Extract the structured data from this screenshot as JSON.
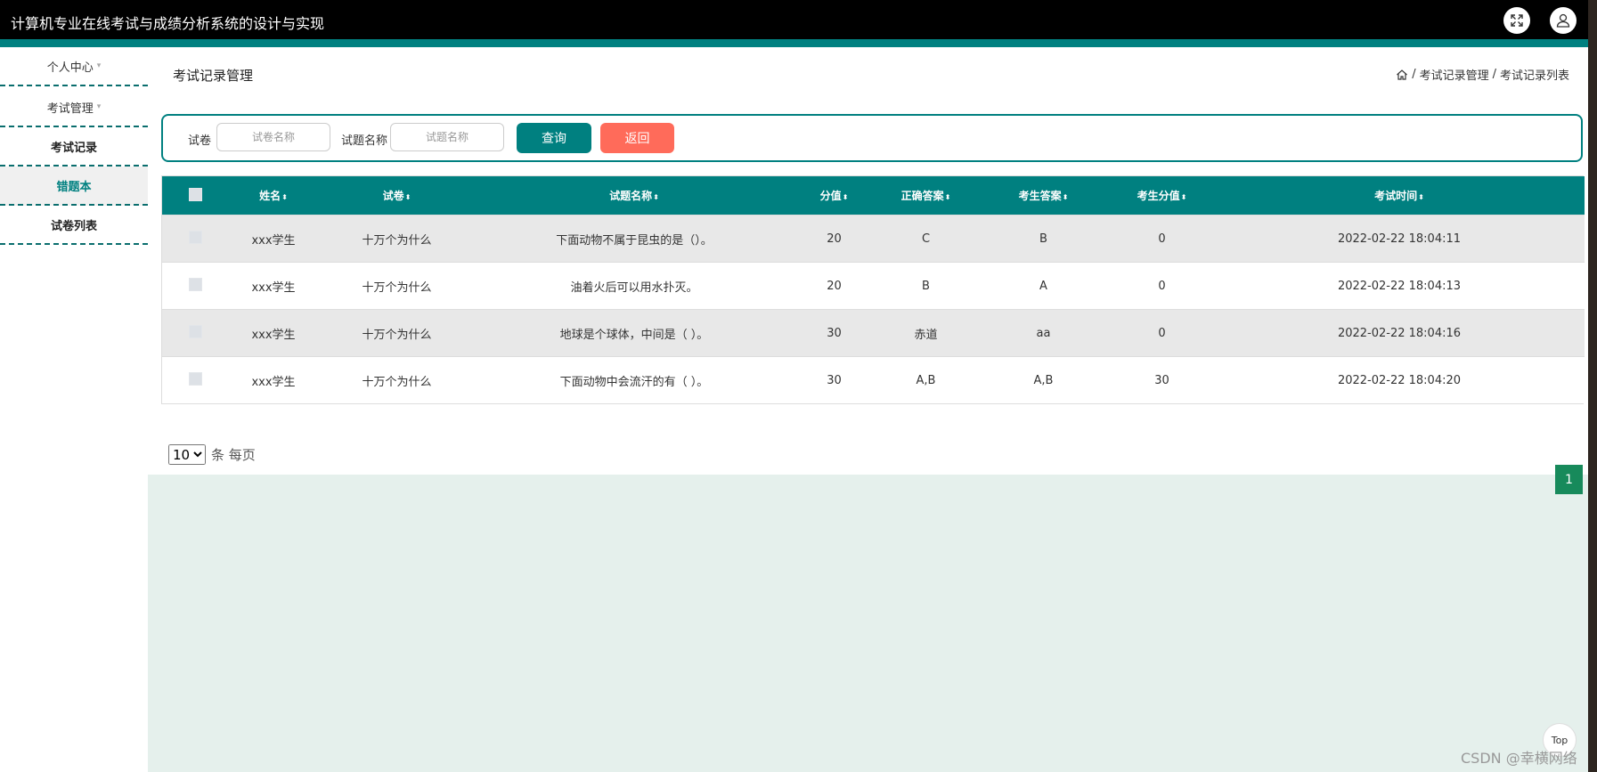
{
  "app": {
    "title": "计算机专业在线考试与成绩分析系统的设计与实现"
  },
  "header": {
    "fullscreen_icon": "expand-icon",
    "user_icon": "user-icon"
  },
  "sidebar": {
    "items": [
      {
        "label": "个人中心",
        "caret": "▾"
      },
      {
        "label": "考试管理",
        "caret": "▾"
      },
      {
        "label": "考试记录"
      },
      {
        "label": "错题本"
      },
      {
        "label": "试卷列表"
      }
    ]
  },
  "page": {
    "title": "考试记录管理",
    "breadcrumb": [
      "考试记录管理",
      "考试记录列表"
    ],
    "separator": "/"
  },
  "search": {
    "paper_label": "试卷",
    "paper_placeholder": "试卷名称",
    "question_label": "试题名称",
    "question_placeholder": "试题名称",
    "query_button": "查询",
    "back_button": "返回"
  },
  "table": {
    "columns": [
      "姓名",
      "试卷",
      "试题名称",
      "分值",
      "正确答案",
      "考生答案",
      "考生分值",
      "考试时间"
    ],
    "sort_symbol": "⬍",
    "rows": [
      {
        "name": "xxx学生",
        "paper": "十万个为什么",
        "question": "下面动物不属于昆虫的是（）。",
        "score": "20",
        "correct": "C",
        "answer": "B",
        "got": "0",
        "time": "2022-02-22 18:04:11"
      },
      {
        "name": "xxx学生",
        "paper": "十万个为什么",
        "question": "油着火后可以用水扑灭。",
        "score": "20",
        "correct": "B",
        "answer": "A",
        "got": "0",
        "time": "2022-02-22 18:04:13"
      },
      {
        "name": "xxx学生",
        "paper": "十万个为什么",
        "question": "地球是个球体，中间是（ ）。",
        "score": "30",
        "correct": "赤道",
        "answer": "aa",
        "got": "0",
        "time": "2022-02-22 18:04:16"
      },
      {
        "name": "xxx学生",
        "paper": "十万个为什么",
        "question": "下面动物中会流汗的有（ ）。",
        "score": "30",
        "correct": "A,B",
        "answer": "A,B",
        "got": "30",
        "time": "2022-02-22 18:04:20"
      }
    ]
  },
  "pagination": {
    "page_size": "10",
    "page_size_suffix": "条 每页",
    "current_page": "1"
  },
  "footer": {
    "top_button": "Top",
    "watermark": "CSDN @幸横网络"
  },
  "colors": {
    "teal": "#008080",
    "query_button": "#008080",
    "back_button": "#ff6b5a",
    "page_button": "#178a5b"
  }
}
